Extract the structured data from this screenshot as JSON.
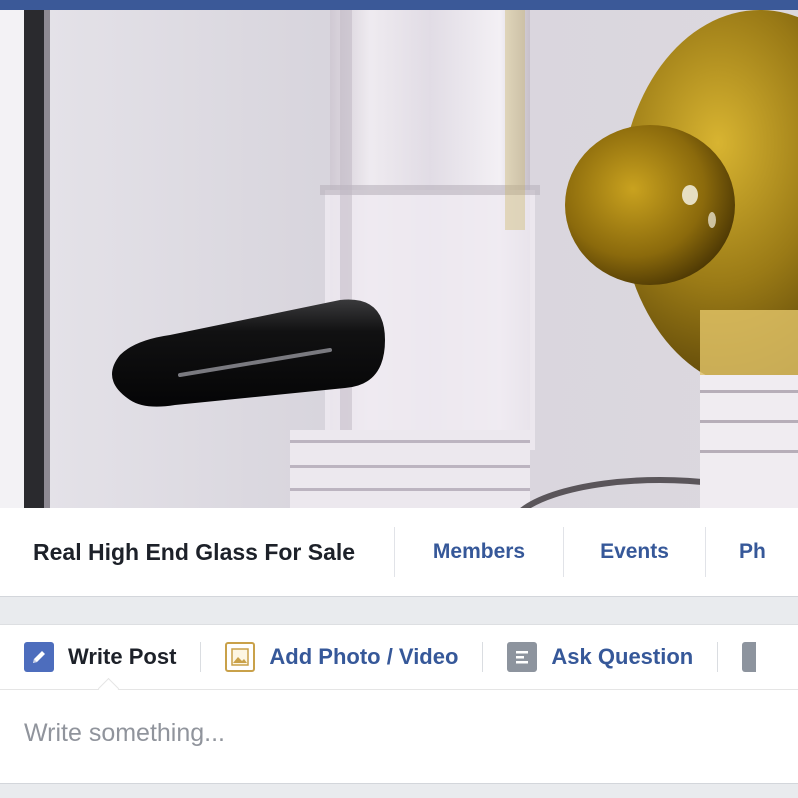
{
  "group": {
    "name": "Real High End Glass For Sale",
    "tabs": [
      {
        "label": "Members"
      },
      {
        "label": "Events"
      },
      {
        "label": "Ph"
      }
    ]
  },
  "composer": {
    "actions": [
      {
        "label": "Write Post",
        "icon": "pencil-icon"
      },
      {
        "label": "Add Photo / Video",
        "icon": "photo-icon"
      },
      {
        "label": "Ask Question",
        "icon": "question-list-icon"
      },
      {
        "label": "",
        "icon": "more-icon"
      }
    ],
    "placeholder": "Write something..."
  },
  "colors": {
    "brand_blue": "#3b5998",
    "link_blue": "#365899",
    "page_bg": "#e9ebee"
  }
}
